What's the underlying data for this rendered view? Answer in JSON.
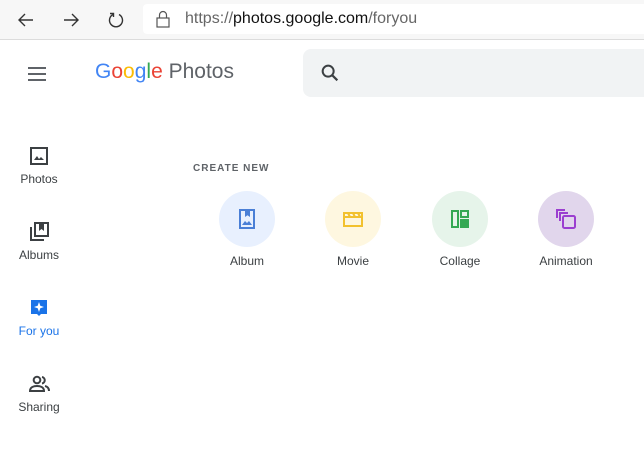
{
  "browser": {
    "url_prefix": "https://",
    "url_host": "photos.google.com",
    "url_path": "/foryou"
  },
  "header": {
    "logo_g": [
      "G",
      "o",
      "o",
      "g",
      "l",
      "e"
    ],
    "logo_product": "Photos",
    "logo_colors": [
      "#4285f4",
      "#ea4335",
      "#fbbc05",
      "#4285f4",
      "#34a853",
      "#ea4335"
    ]
  },
  "sidebar": {
    "items": [
      {
        "label": "Photos"
      },
      {
        "label": "Albums"
      },
      {
        "label": "For you"
      },
      {
        "label": "Sharing"
      }
    ]
  },
  "main": {
    "create_new_label": "CREATE NEW",
    "tiles": [
      {
        "label": "Album",
        "bg": "#e8f0fe",
        "fg": "#4a7fd6"
      },
      {
        "label": "Movie",
        "bg": "#fef7e0",
        "fg": "#f2c12e"
      },
      {
        "label": "Collage",
        "bg": "#e6f4ea",
        "fg": "#34a853"
      },
      {
        "label": "Animation",
        "bg": "#e1d6ec",
        "fg": "#9b3fd0"
      }
    ]
  },
  "colors": {
    "accent": "#1a73e8",
    "icon": "#5f6368"
  }
}
